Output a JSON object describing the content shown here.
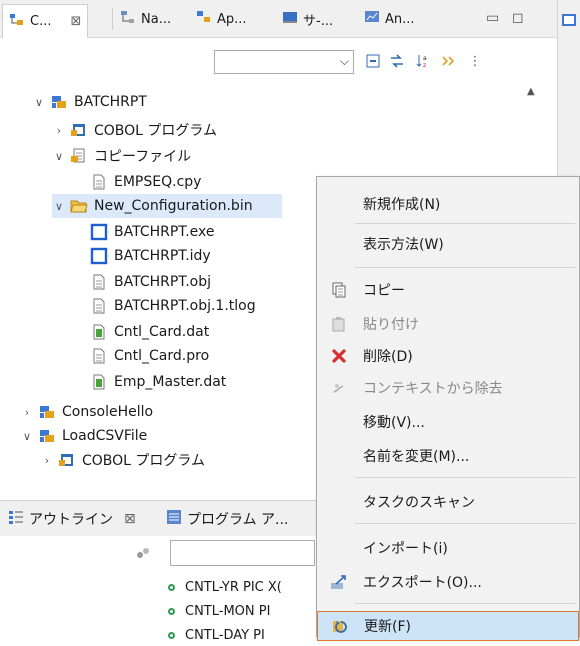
{
  "tabs": [
    {
      "label": "C...",
      "close": "⊠",
      "icon": "project-explorer-icon"
    },
    {
      "label": "Na...",
      "icon": "navigator-icon"
    },
    {
      "label": "Ap...",
      "icon": "application-explorer-icon"
    },
    {
      "label": "サ-...",
      "icon": "server-icon"
    },
    {
      "label": "An...",
      "icon": "analysis-icon"
    }
  ],
  "tree": [
    {
      "label": "BATCHRPT",
      "twisty": "∨",
      "icon": "project"
    },
    {
      "label": "COBOL プログラム",
      "twisty": "›",
      "icon": "cobol-folder"
    },
    {
      "label": "コピーファイル",
      "twisty": "∨",
      "icon": "copybook-folder"
    },
    {
      "label": "EMPSEQ.cpy",
      "twisty": "",
      "icon": "file"
    },
    {
      "label": "New_Configuration.bin",
      "twisty": "∨",
      "icon": "folder-open"
    },
    {
      "label": "BATCHRPT.exe",
      "twisty": "",
      "icon": "blue-box"
    },
    {
      "label": "BATCHRPT.idy",
      "twisty": "",
      "icon": "blue-box"
    },
    {
      "label": "BATCHRPT.obj",
      "twisty": "",
      "icon": "file"
    },
    {
      "label": "BATCHRPT.obj.1.tlog",
      "twisty": "",
      "icon": "file"
    },
    {
      "label": "Cntl_Card.dat",
      "twisty": "",
      "icon": "green-file"
    },
    {
      "label": "Cntl_Card.pro",
      "twisty": "",
      "icon": "file"
    },
    {
      "label": "Emp_Master.dat",
      "twisty": "",
      "icon": "green-file"
    },
    {
      "label": "ConsoleHello",
      "twisty": "›",
      "icon": "project"
    },
    {
      "label": "LoadCSVFile",
      "twisty": "∨",
      "icon": "project"
    },
    {
      "label": "COBOL プログラム",
      "twisty": "›",
      "icon": "cobol-folder"
    }
  ],
  "outline": {
    "tab1": "アウトライン",
    "tab1_close": "⊠",
    "tab2": "プログラム ア...",
    "rows": [
      "CNTL-YR PIC X(",
      "CNTL-MON PI",
      "CNTL-DAY PI"
    ]
  },
  "menu": {
    "items": [
      {
        "label": "新規作成(N)",
        "icon": "",
        "disabled": false
      },
      {
        "label": "表示方法(W)",
        "icon": "",
        "disabled": false
      },
      {
        "label": "コピー",
        "icon": "copy-icon",
        "disabled": false
      },
      {
        "label": "貼り付け",
        "icon": "paste-icon",
        "disabled": true
      },
      {
        "label": "削除(D)",
        "icon": "delete-icon",
        "disabled": false
      },
      {
        "label": "コンテキストから除去",
        "icon": "remove-context-icon",
        "disabled": true
      },
      {
        "label": "移動(V)...",
        "icon": "",
        "disabled": false
      },
      {
        "label": "名前を変更(M)...",
        "icon": "",
        "disabled": false
      },
      {
        "label": "タスクのスキャン",
        "icon": "",
        "disabled": false
      },
      {
        "label": "インポート(i)",
        "icon": "",
        "disabled": false
      },
      {
        "label": "エクスポート(O)...",
        "icon": "export-icon",
        "disabled": false
      },
      {
        "label": "更新(F)",
        "icon": "refresh-icon",
        "disabled": false
      }
    ]
  },
  "colors": {
    "selection": "#dbe9fb",
    "menu_hover": "#cde3f7",
    "menu_hover_border": "#e0782c",
    "delete_red": "#d62f2f"
  }
}
